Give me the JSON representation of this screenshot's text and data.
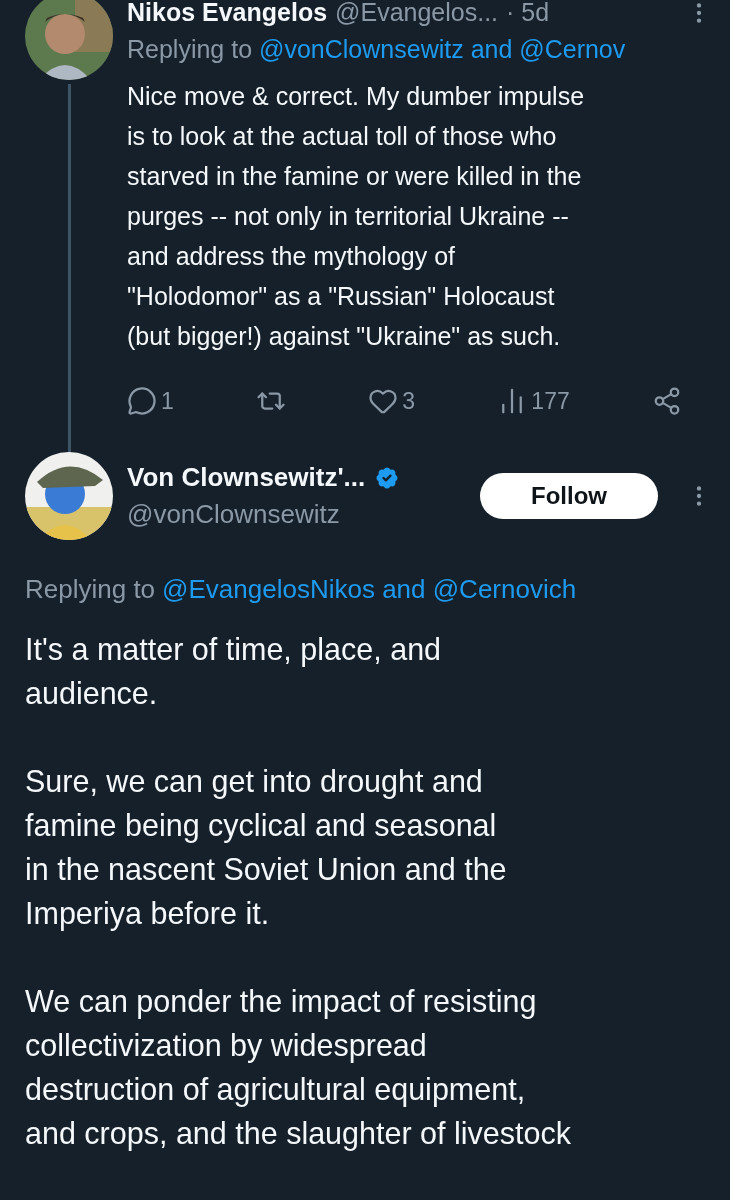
{
  "reply_tweet": {
    "name": "Nikos Evangelos",
    "handle": "@Evangelos...",
    "time": "· 5d",
    "replying_prefix": "Replying to",
    "replying_to": "@vonClownsewitz and @Cernov",
    "body_lines": [
      "Nice move & correct. My dumber impulse",
      "is to look at the actual toll of those who",
      "starved in the famine or were killed in the",
      "purges -- not only in territorial Ukraine --",
      "and address the mythology of",
      "\"Holodomor\" as a \"Russian\" Holocaust",
      "(but bigger!) against \"Ukraine\" as such."
    ],
    "actions": [
      {
        "kind": "reply",
        "count": "1"
      },
      {
        "kind": "repost"
      },
      {
        "kind": "like",
        "count": "3"
      },
      {
        "kind": "views",
        "count": "177"
      },
      {
        "kind": "share"
      }
    ]
  },
  "main_tweet": {
    "name": "Von Clownsewitz'...",
    "verified": true,
    "handle": "@vonClownsewitz",
    "follow_button": "Follow",
    "replying_prefix": "Replying to",
    "replying_to": "@EvangelosNikos and @Cernovich",
    "paragraphs": [
      [
        "It's a matter of time, place, and",
        "audience."
      ],
      [
        "Sure, we can get into drought and",
        "famine being cyclical and seasonal",
        "in the nascent Soviet Union and the",
        "Imperiya before it."
      ],
      [
        "We can ponder the impact of resisting",
        "collectivization by widespread",
        "destruction of agricultural equipment,",
        "and crops, and the slaughter of livestock"
      ]
    ]
  }
}
